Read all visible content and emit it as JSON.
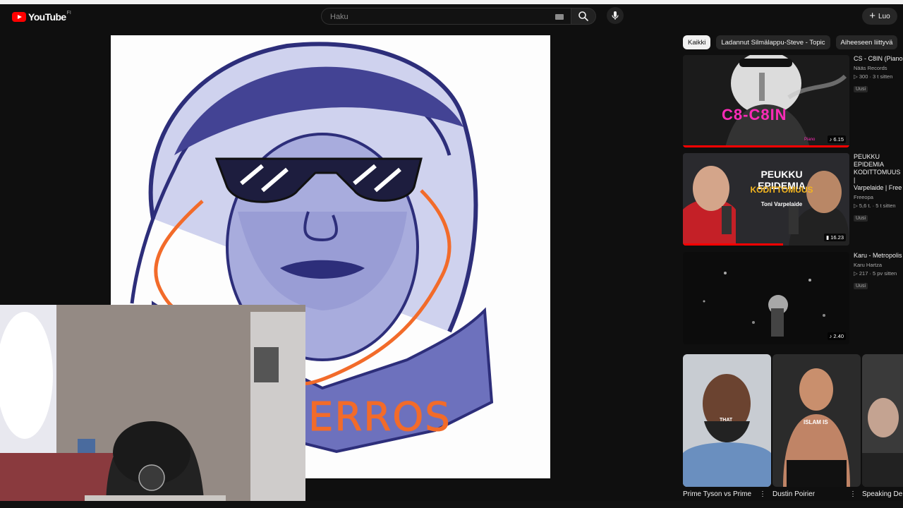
{
  "masthead": {
    "logo_text": "YouTube",
    "logo_country": "FI",
    "search_placeholder": "Haku",
    "create_label": "Luo",
    "icons": [
      "keyboard-icon",
      "search-icon",
      "mic-icon",
      "plus-icon"
    ]
  },
  "player": {
    "caption_text": "KERROS"
  },
  "chips": [
    "Kaikki",
    "Ladannut Silmälappu-Steve - Topic",
    "Aiheeseen liittyvä"
  ],
  "recommendations": [
    {
      "title": "CS - C8IN (Piano",
      "channel": "Nääs Records",
      "stats": "▷ 300 · 3 t sitten",
      "badge": "Uusi",
      "duration": "♪ 6.15",
      "overlay_text": "C8-C8IN",
      "overlay_small": "Piano",
      "progress": 1.0
    },
    {
      "title": "PEUKKU EPIDEMIA\nKODITTOMUUS |\nVarpelaide | Free",
      "channel": "Freeopa",
      "stats": "▷ 5,6 t. · 5 t sitten",
      "badge": "Uusi",
      "duration": "▮ 16.23",
      "overlay_text": "PEUKKU EPIDEMIA",
      "overlay_small": "KODITTOMUUS",
      "overlay_name": "Toni Varpelaide",
      "progress": 0.6
    },
    {
      "title": "Karu - Metropolis",
      "channel": "Karu Hartza",
      "stats": "▷ 217 · 5 pv sitten",
      "badge": "Uusi",
      "duration": "♪ 2.40",
      "progress": 0
    }
  ],
  "shorts": [
    {
      "title": "Prime Tyson vs Prime",
      "overlay": "THAT"
    },
    {
      "title": "Dustin Poirier",
      "overlay": "ISLAM IS"
    },
    {
      "title": "Speaking De",
      "overlay": ""
    }
  ],
  "colors": {
    "accent": "#ff0000",
    "background": "#0f0f0f",
    "chip_active": "#f1f1f1"
  }
}
